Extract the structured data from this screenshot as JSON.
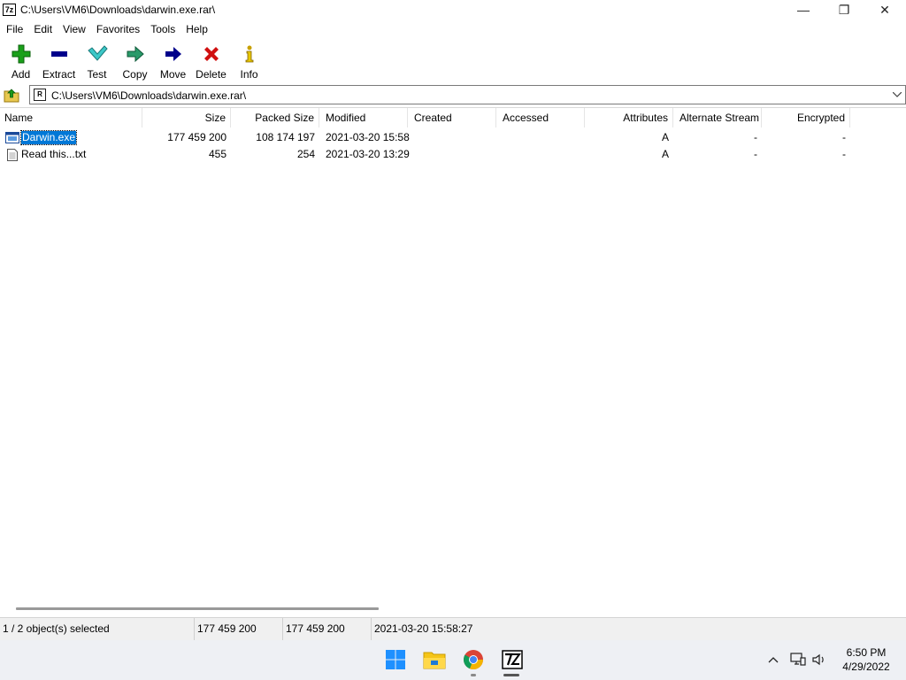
{
  "window": {
    "title": "C:\\Users\\VM6\\Downloads\\darwin.exe.rar\\",
    "app_icon_text": "7z",
    "minimize_glyph": "—",
    "maximize_glyph": "❐",
    "close_glyph": "✕"
  },
  "menu": [
    "File",
    "Edit",
    "View",
    "Favorites",
    "Tools",
    "Help"
  ],
  "toolbar": {
    "add": "Add",
    "extract": "Extract",
    "test": "Test",
    "copy": "Copy",
    "move": "Move",
    "delete": "Delete",
    "info": "Info"
  },
  "address": {
    "path": "C:\\Users\\VM6\\Downloads\\darwin.exe.rar\\",
    "icon_text": "R"
  },
  "columns": {
    "name": "Name",
    "size": "Size",
    "packed_size": "Packed Size",
    "modified": "Modified",
    "created": "Created",
    "accessed": "Accessed",
    "attributes": "Attributes",
    "alternate_stream": "Alternate Stream",
    "encrypted": "Encrypted"
  },
  "files": [
    {
      "name": "Darwin.exe",
      "size": "177 459 200",
      "packed_size": "108 174 197",
      "modified": "2021-03-20 15:58",
      "created": "",
      "accessed": "",
      "attributes": "A",
      "alternate_stream": "-",
      "encrypted": "-",
      "selected": true,
      "icon": "exe-file-icon"
    },
    {
      "name": "Read this...txt",
      "size": "455",
      "packed_size": "254",
      "modified": "2021-03-20 13:29",
      "created": "",
      "accessed": "",
      "attributes": "A",
      "alternate_stream": "-",
      "encrypted": "-",
      "selected": false,
      "icon": "text-file-icon"
    }
  ],
  "status": {
    "selection": "1 / 2 object(s) selected",
    "size": "177 459 200",
    "packed": "177 459 200",
    "modified": "2021-03-20 15:58:27"
  },
  "taskbar": {
    "time": "6:50 PM",
    "date": "4/29/2022",
    "icons": [
      "windows-start-icon",
      "file-explorer-icon",
      "chrome-icon",
      "7zip-icon"
    ]
  },
  "colors": {
    "selection": "#0078d7",
    "add_green": "#1aa01a",
    "extract_blue": "#00008b",
    "delete_red": "#d01010",
    "test_teal": "#3cc8c8"
  }
}
